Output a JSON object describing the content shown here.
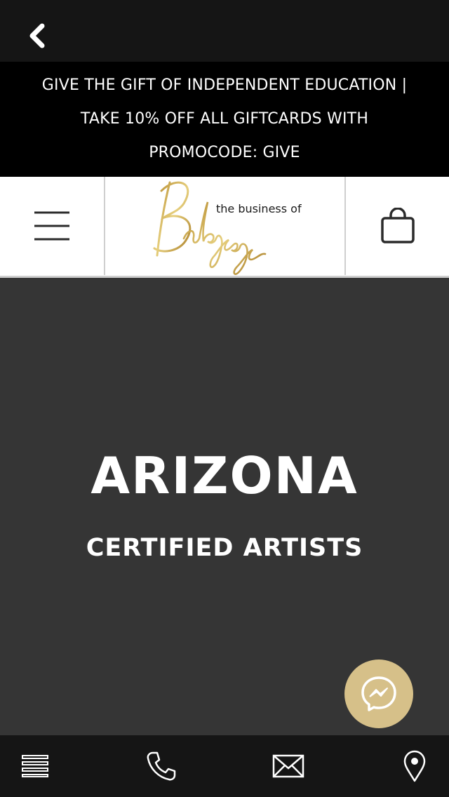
{
  "nav": {
    "back_icon": "chevron-left-icon"
  },
  "promo": {
    "lines": [
      "GIVE THE GIFT OF INDEPENDENT EDUCATION |",
      "TAKE 10% OFF ALL GIFTCARDS WITH",
      "PROMOCODE: GIVE"
    ]
  },
  "header": {
    "menu_icon": "hamburger-menu-icon",
    "logo": {
      "small_text": "the business of",
      "script_text": "Balayage"
    },
    "cart_icon": "shopping-bag-icon"
  },
  "hero": {
    "title": "ARIZONA",
    "subtitle": "CERTIFIED ARTISTS"
  },
  "chat": {
    "icon": "messenger-icon",
    "color": "#d6c089"
  },
  "bottom_tabs": [
    {
      "icon": "list-icon"
    },
    {
      "icon": "phone-icon"
    },
    {
      "icon": "mail-icon"
    },
    {
      "icon": "location-pin-icon"
    }
  ],
  "colors": {
    "bar_bg": "#151515",
    "promo_bg": "#000000",
    "hero_bg": "#353535",
    "gold": "#c9a94e"
  }
}
